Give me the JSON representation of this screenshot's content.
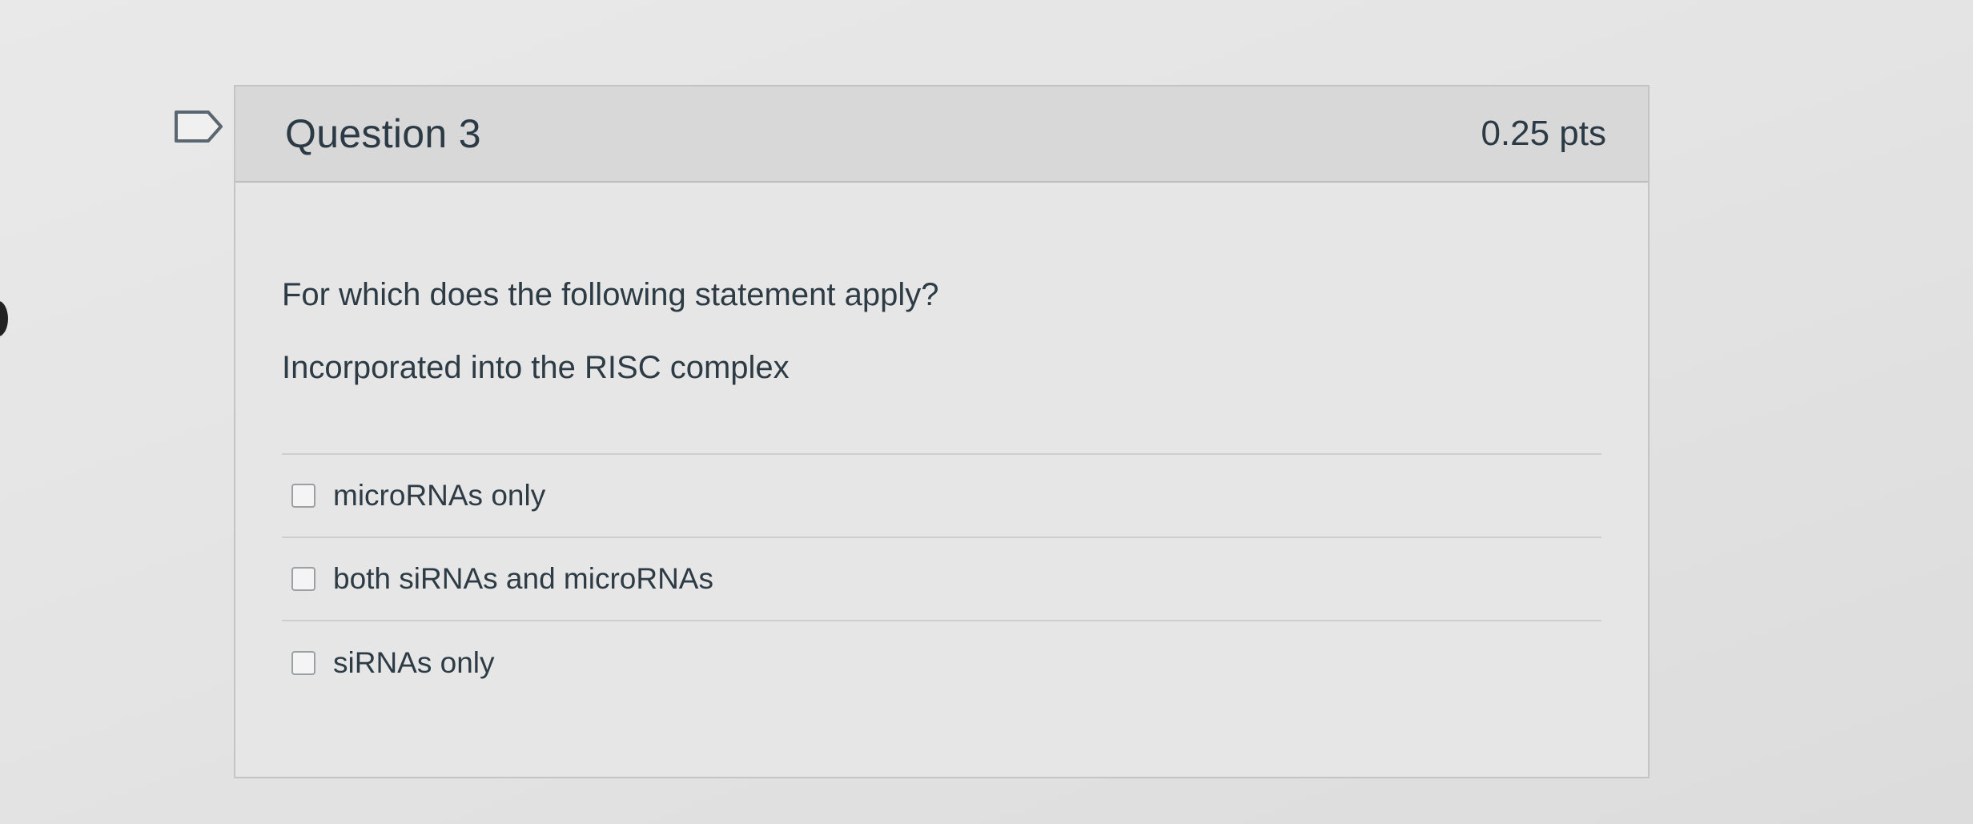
{
  "question": {
    "title": "Question 3",
    "points": "0.25 pts",
    "prompt": "For which does the following statement apply?",
    "statement": "Incorporated into the RISC complex",
    "answers": [
      {
        "label": "microRNAs only",
        "checked": false
      },
      {
        "label": "both siRNAs and microRNAs",
        "checked": false
      },
      {
        "label": "siRNAs only",
        "checked": false
      }
    ]
  },
  "icons": {
    "flag": "flag-question-icon"
  },
  "colors": {
    "header_bg": "#d8d8d8",
    "card_bg": "#e6e6e6",
    "text": "#2d3b45"
  }
}
